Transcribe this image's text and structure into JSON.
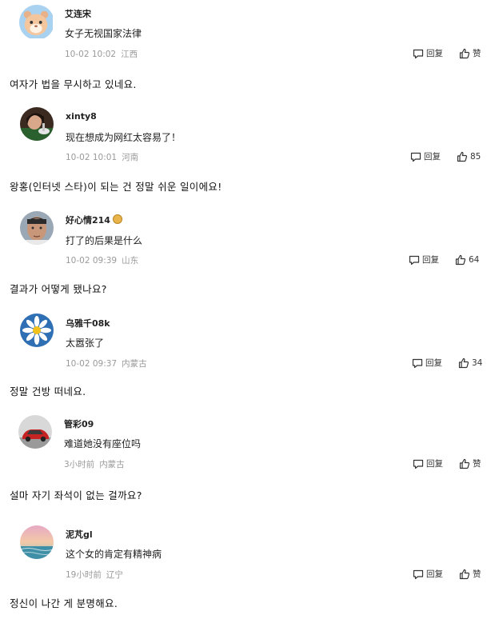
{
  "comments": [
    {
      "username": "艾连宋",
      "text": "女子无视国家法律",
      "time": "10-02 10:02",
      "location": "江西",
      "reply_label": "回复",
      "like_label": "赞",
      "translation": "여자가 법을 무시하고 있네요.",
      "avatar_icon": "cartoon-hamster-avatar"
    },
    {
      "username": "xinty8",
      "text": "现在想成为网红太容易了！",
      "time": "10-02 10:01",
      "location": "河南",
      "reply_label": "回复",
      "like_label": "85",
      "translation": "왕홍(인터넷 스타)이 되는 건 정말 쉬운 일이에요!",
      "avatar_icon": "photo-person-avatar"
    },
    {
      "username": "好心情214",
      "text": "打了的后果是什么",
      "time": "10-02 09:39",
      "location": "山东",
      "reply_label": "回复",
      "like_label": "64",
      "translation": "결과가 어떻게 됐나요?",
      "avatar_icon": "man-face-avatar"
    },
    {
      "username": "乌雅千08k",
      "text": "太嚣张了",
      "time": "10-02 09:37",
      "location": "内蒙古",
      "reply_label": "回复",
      "like_label": "34",
      "translation": "정말 건방 떠네요.",
      "avatar_icon": "daisy-flower-avatar"
    },
    {
      "username": "管彩09",
      "text": "难道她没有座位吗",
      "time": "3小时前",
      "location": "内蒙古",
      "reply_label": "回复",
      "like_label": "赞",
      "translation": "설마 자기 좌석이 없는 걸까요?",
      "avatar_icon": "red-car-avatar"
    },
    {
      "username": "泥芃gl",
      "text": "这个女的肯定有精神病",
      "time": "19小时前",
      "location": "辽宁",
      "reply_label": "回复",
      "like_label": "赞",
      "translation": "정신이 나간 게 분명해요.",
      "avatar_icon": "sunset-sea-avatar"
    }
  ],
  "colors": {
    "meta_text": "#9a9a9a",
    "primary_text": "#222222",
    "badge": "#e9b44c"
  }
}
